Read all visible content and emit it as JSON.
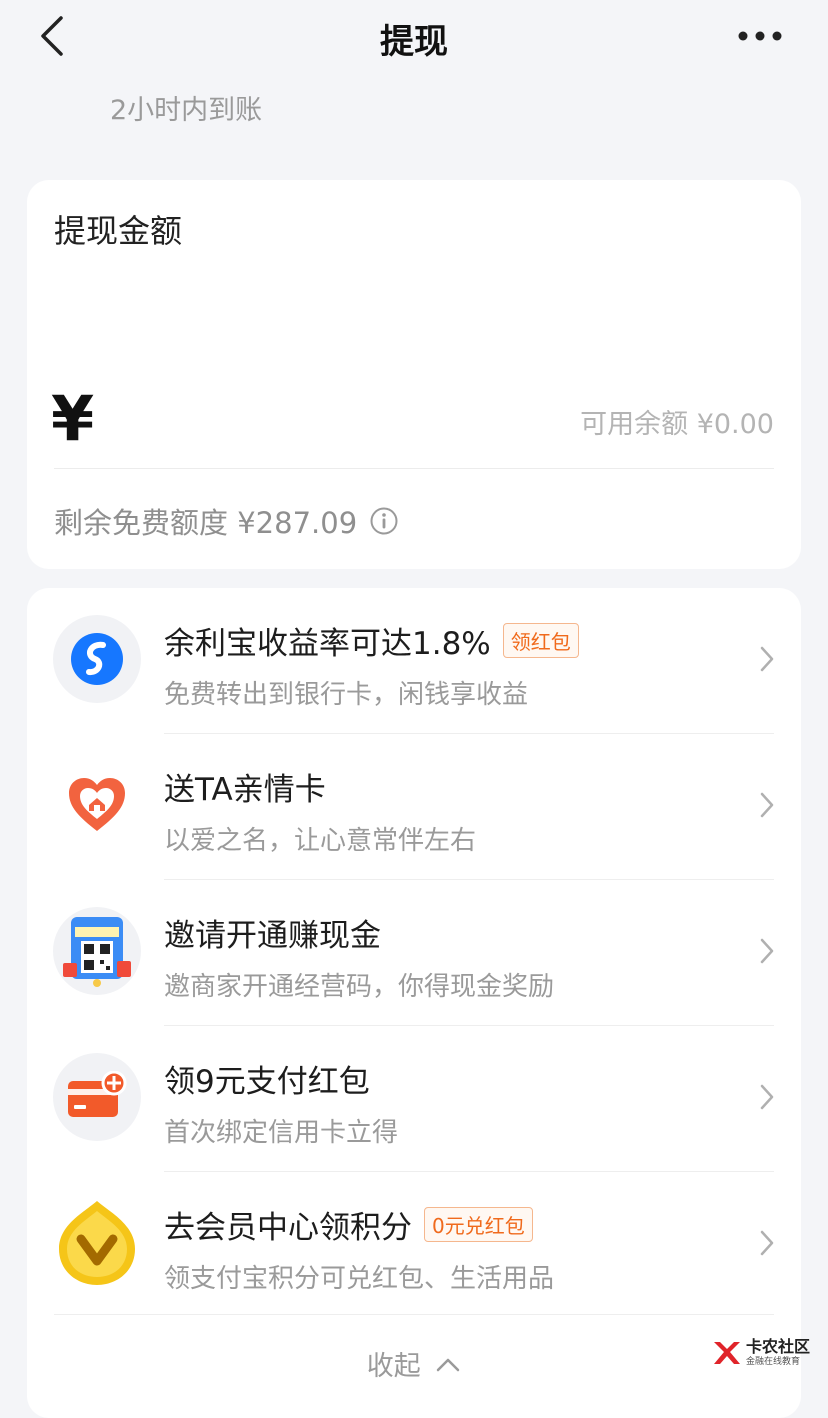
{
  "nav": {
    "title": "提现"
  },
  "arrival_hint": "2小时内到账",
  "amount_card": {
    "title": "提现金额",
    "currency_symbol": "¥",
    "available_balance": "可用余额 ¥0.00",
    "free_quota": "剩余免费额度 ¥287.09"
  },
  "services": [
    {
      "title": "余利宝收益率可达1.8%",
      "tag": "领红包",
      "subtitle": "免费转出到银行卡，闲钱享收益",
      "icon": "yulibao-icon"
    },
    {
      "title": "送TA亲情卡",
      "tag": "",
      "subtitle": "以爱之名，让心意常伴左右",
      "icon": "family-card-icon"
    },
    {
      "title": "邀请开通赚现金",
      "tag": "",
      "subtitle": "邀商家开通经营码，你得现金奖励",
      "icon": "invite-qr-icon"
    },
    {
      "title": "领9元支付红包",
      "tag": "",
      "subtitle": "首次绑定信用卡立得",
      "icon": "credit-card-plus-icon"
    },
    {
      "title": "去会员中心领积分",
      "tag": "0元兑红包",
      "subtitle": "领支付宝积分可兑红包、生活用品",
      "icon": "vip-badge-icon"
    }
  ],
  "collapse_label": "收起",
  "watermark": {
    "name": "卡农社区",
    "slogan": "金融在线教育"
  },
  "colors": {
    "accent_orange": "#f06a1c",
    "alipay_blue": "#1677ff"
  }
}
